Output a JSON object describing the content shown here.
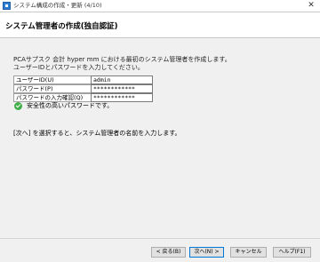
{
  "window": {
    "title": "システム構成の作成・更新 (4/10)",
    "close_glyph": "✕",
    "icon": "app-icon"
  },
  "header": {
    "title": "システム管理者の作成(独自認証)"
  },
  "main": {
    "description_line1": "PCAサプスク 会計 hyper mm における最初のシステム管理者を作成します。",
    "description_line2": "ユーザーIDとパスワードを入力してください。",
    "form": {
      "user_id_label": "ユーザーID(U)",
      "user_id_value": "admin",
      "password_label": "パスワード(P)",
      "password_value": "************",
      "password_confirm_label": "パスワードの入力確認(Q)",
      "password_confirm_value": "************"
    },
    "status_icon": "check-circle-icon",
    "status_color": "#3fae49",
    "status_text": "安全性の高いパスワードです。",
    "hint": "[次へ] を選択すると、システム管理者の名前を入力します。"
  },
  "footer": {
    "back_label": "< 戻る(B)",
    "next_label": "次へ(N) >",
    "cancel_label": "キャンセル",
    "help_label": "ヘルプ(F1)"
  }
}
